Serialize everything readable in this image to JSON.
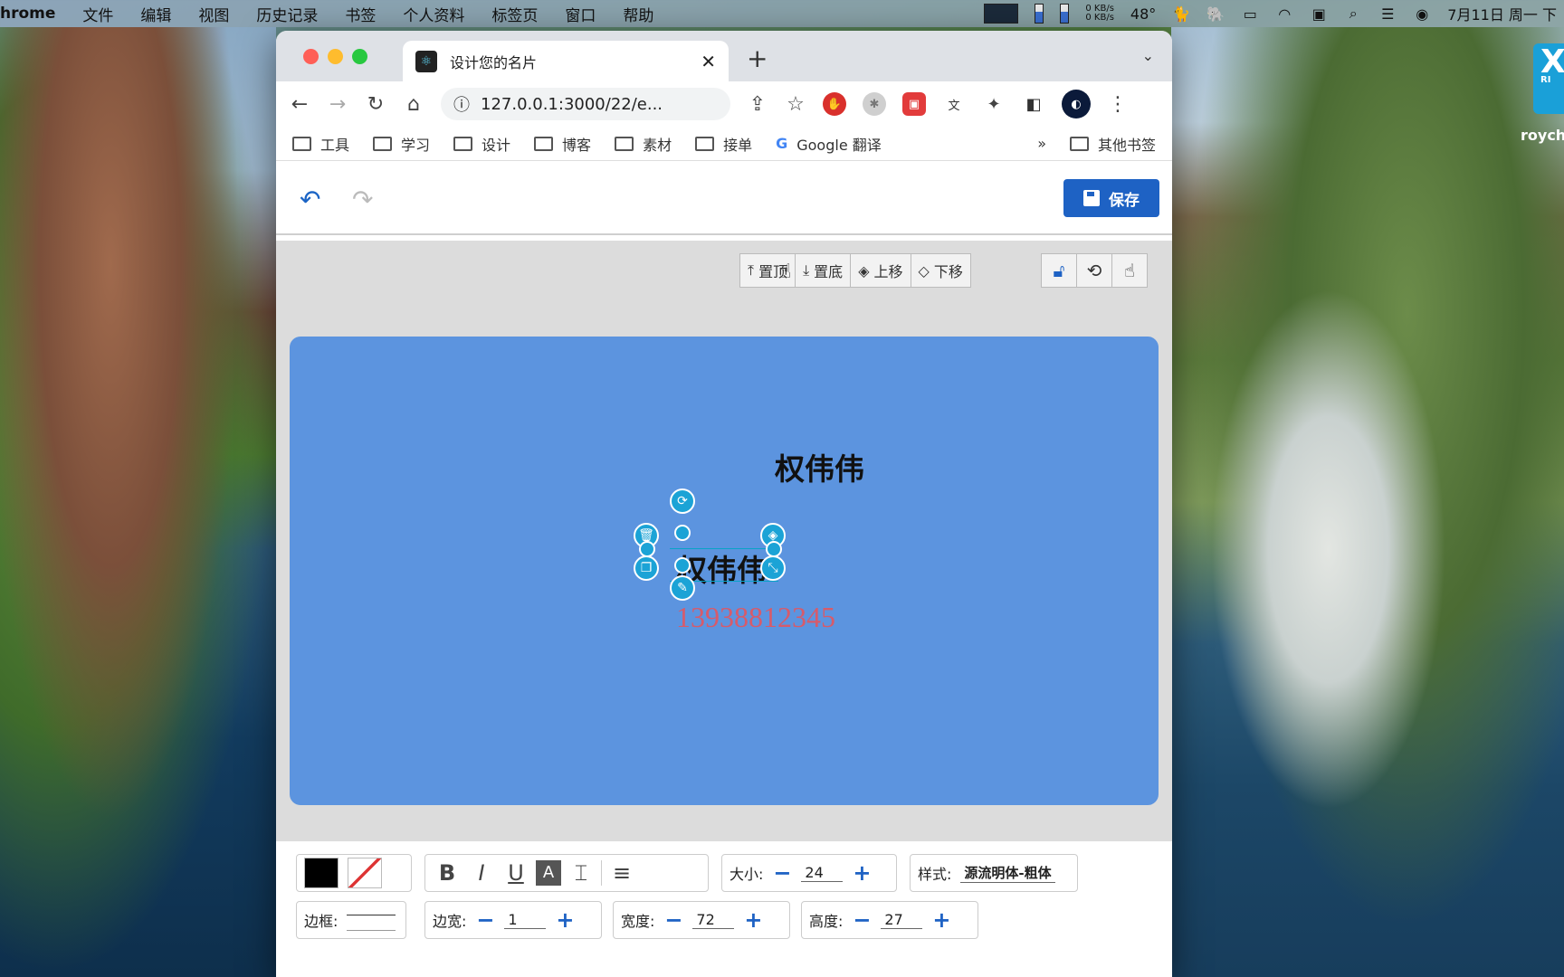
{
  "menubar": {
    "app": "hrome",
    "items": [
      "文件",
      "编辑",
      "视图",
      "历史记录",
      "书签",
      "个人资料",
      "标签页",
      "窗口",
      "帮助"
    ],
    "net_up": "0 KB/s",
    "net_down": "0 KB/s",
    "temp": "48°",
    "datetime": "7月11日 周一 下"
  },
  "widget": {
    "letter": "X",
    "sub": "RI",
    "label": "roych"
  },
  "browser": {
    "tab_title": "设计您的名片",
    "tab_close": "✕",
    "new_tab": "+",
    "url": "127.0.0.1:3000/22/e...",
    "bookmarks": [
      "工具",
      "学习",
      "设计",
      "博客",
      "素材",
      "接单"
    ],
    "google_translate": "Google 翻译",
    "more": "»",
    "other_bookmarks": "其他书签"
  },
  "editor": {
    "save_label": "保存",
    "layer_buttons": [
      "置顶",
      "置底",
      "上移",
      "下移"
    ],
    "card": {
      "name_top": "权伟伟",
      "name_selected": "权伟伟",
      "phone": "13938812345",
      "background": "#5c94df",
      "phone_color": "#d65b6b"
    },
    "toolbar": {
      "size_label": "大小:",
      "size_value": "24",
      "style_label": "样式:",
      "style_value": "源流明体-粗体",
      "border_label": "边框:",
      "border_width_label": "边宽:",
      "border_width_value": "1",
      "width_label": "宽度:",
      "width_value": "72",
      "height_label": "高度:",
      "height_value": "27",
      "bold": "B",
      "italic": "I",
      "underline": "U",
      "color_a": "A",
      "text_color": "#000000"
    }
  }
}
